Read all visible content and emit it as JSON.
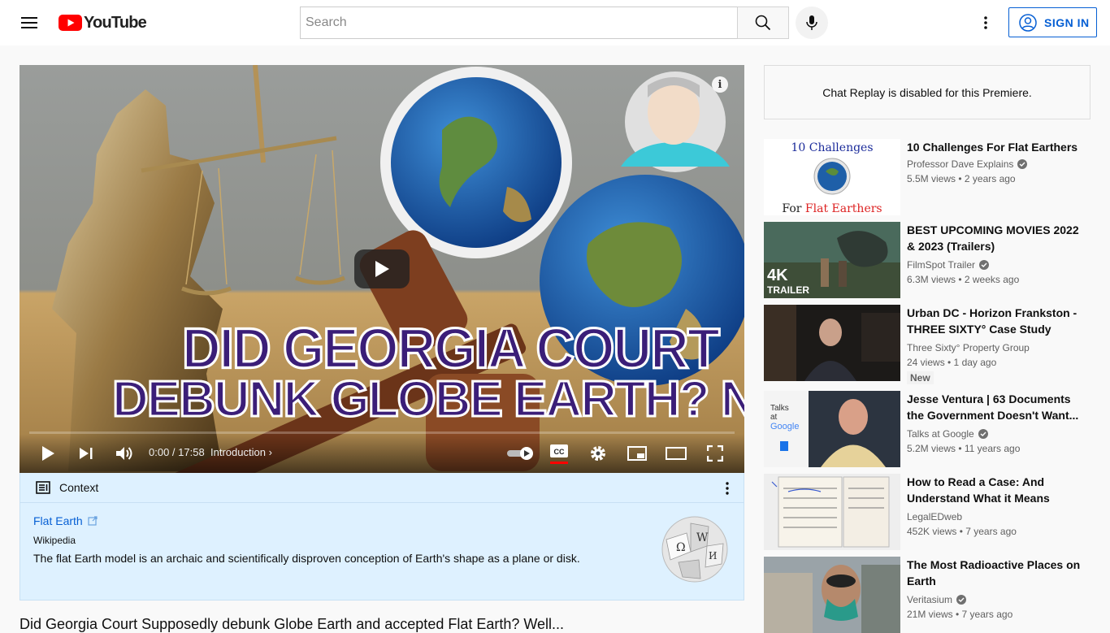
{
  "header": {
    "logo_text": "YouTube",
    "search_placeholder": "Search",
    "signin_label": "SIGN IN"
  },
  "player": {
    "thumbnail_line1": "DID GEORGIA COURT",
    "thumbnail_line2": "DEBUNK GLOBE EARTH? NOPE.",
    "time": "0:00 / 17:58",
    "chapter": "Introduction",
    "info_icon_label": "i"
  },
  "context": {
    "header": "Context",
    "link": "Flat Earth",
    "source": "Wikipedia",
    "description": "The flat Earth model is an archaic and scientifically disproven conception of Earth's shape as a plane or disk."
  },
  "video_title": "Did Georgia Court Supposedly debunk Globe Earth and accepted Flat Earth? Well...",
  "chat_replay": "Chat Replay is disabled for this Premiere.",
  "recommendations": [
    {
      "title": "10 Challenges For Flat Earthers",
      "channel": "Professor Dave Explains",
      "verified": true,
      "meta": "5.5M views • 2 years ago",
      "thumb_text_top": "10 Challenges",
      "thumb_text_for": "For ",
      "thumb_text_bottom": "Flat Earthers"
    },
    {
      "title": "BEST UPCOMING MOVIES 2022 & 2023 (Trailers)",
      "channel": "FilmSpot Trailer",
      "verified": true,
      "meta": "6.3M views • 2 weeks ago",
      "thumb_text_4k": "4K",
      "thumb_text_trailer": "TRAILER"
    },
    {
      "title": "Urban DC - Horizon Frankston - THREE SIXTY° Case Study",
      "channel": "Three Sixty° Property Group",
      "verified": false,
      "meta": "24 views • 1 day ago",
      "badge": "New"
    },
    {
      "title": "Jesse Ventura | 63 Documents the Government Doesn't Want...",
      "channel": "Talks at Google",
      "verified": true,
      "meta": "5.2M views • 11 years ago",
      "thumb_text_talks": "Talks",
      "thumb_text_at": "at",
      "thumb_text_google": "Google"
    },
    {
      "title": "How to Read a Case: And Understand What it Means",
      "channel": "LegalEDweb",
      "verified": false,
      "meta": "452K views • 7 years ago"
    },
    {
      "title": "The Most Radioactive Places on Earth",
      "channel": "Veritasium",
      "verified": true,
      "meta": "21M views • 7 years ago"
    }
  ],
  "colors": {
    "brand_red": "#ff0000",
    "link_blue": "#065fd4",
    "context_bg": "#def1ff"
  }
}
